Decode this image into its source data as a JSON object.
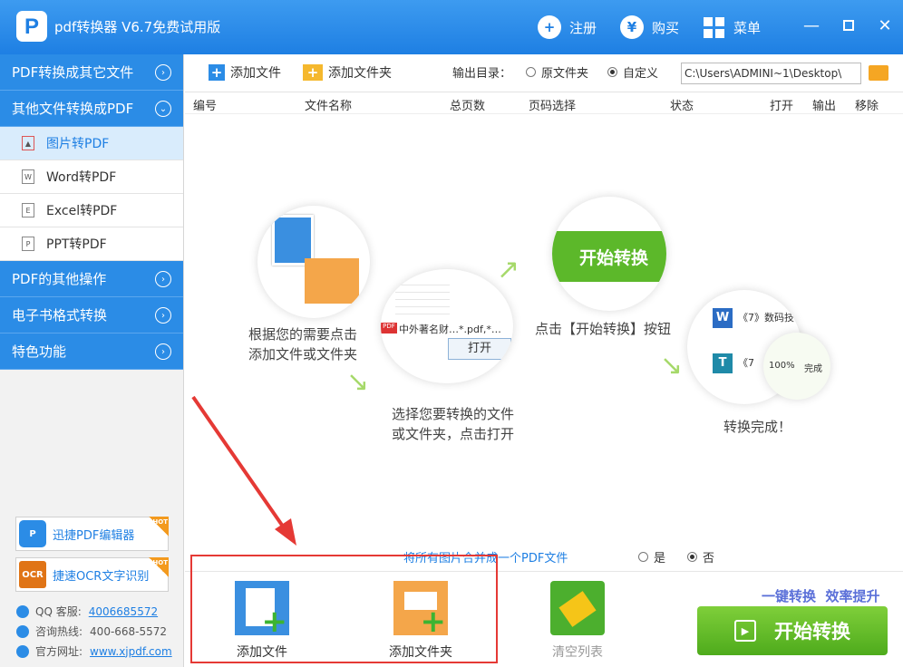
{
  "app": {
    "title": "pdf转换器 V6.7免费试用版",
    "register": "注册",
    "buy": "购买",
    "menu": "菜单"
  },
  "sidebar": {
    "categories": [
      {
        "label": "PDF转换成其它文件"
      },
      {
        "label": "其他文件转换成PDF"
      },
      {
        "label": "PDF的其他操作"
      },
      {
        "label": "电子书格式转换"
      },
      {
        "label": "特色功能"
      }
    ],
    "subitems": [
      {
        "label": "图片转PDF",
        "icon": "image-file-icon"
      },
      {
        "label": "Word转PDF",
        "icon": "word-file-icon"
      },
      {
        "label": "Excel转PDF",
        "icon": "excel-file-icon"
      },
      {
        "label": "PPT转PDF",
        "icon": "ppt-file-icon"
      }
    ],
    "promos": [
      {
        "label": "迅捷PDF编辑器",
        "badge": "HOT"
      },
      {
        "label": "捷速OCR文字识别",
        "badge": "HOT"
      }
    ],
    "contacts": [
      {
        "label": "QQ 客服:",
        "value": "4006685572"
      },
      {
        "label": "咨询热线:",
        "value": "400-668-5572"
      },
      {
        "label": "官方网址:",
        "value": "www.xjpdf.com"
      }
    ]
  },
  "toolbar": {
    "add_file": "添加文件",
    "add_folder": "添加文件夹",
    "output_label": "输出目录：",
    "opt_original": "原文件夹",
    "opt_custom": "自定义",
    "path": "C:\\Users\\ADMINI~1\\Desktop\\"
  },
  "table": {
    "columns": [
      "编号",
      "文件名称",
      "总页数",
      "页码选择",
      "状态",
      "打开",
      "输出",
      "移除"
    ]
  },
  "guide": {
    "step1_l1": "根据您的需要点击",
    "step1_l2": "添加文件或文件夹",
    "step2_l1": "选择您要转换的文件",
    "step2_l2": "或文件夹，点击打开",
    "step2_file": "中外著名财…*.pdf,*…",
    "step2_open": "打开",
    "step3_btn": "开始转换",
    "step3_text": "点击【开始转换】按钮",
    "step4_item1": "《7》数码技",
    "step4_item2": "《7",
    "step4_pct": "100%",
    "step4_done": "完成",
    "step4_text": "转换完成！"
  },
  "merge": {
    "label": "将所有图片合并成一个PDF文件",
    "yes": "是",
    "no": "否"
  },
  "bottom": {
    "add_file": "添加文件",
    "add_folder": "添加文件夹",
    "clear": "清空列表",
    "slogan": "一键转换  效率提升",
    "start": "开始转换"
  },
  "colors": {
    "blue": "#2b8ce6",
    "green": "#5cb82a",
    "red": "#e53935"
  }
}
